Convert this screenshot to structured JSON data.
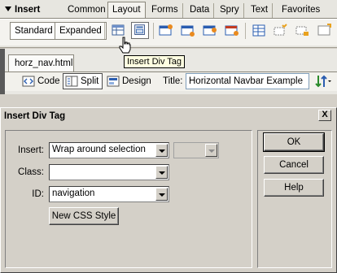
{
  "insert_bar": {
    "title": "Insert",
    "categories": [
      {
        "label": "Common",
        "active": false
      },
      {
        "label": "Layout",
        "active": true
      },
      {
        "label": "Forms",
        "active": false
      },
      {
        "label": "Data",
        "active": false
      },
      {
        "label": "Spry",
        "active": false
      },
      {
        "label": "Text",
        "active": false
      },
      {
        "label": "Favorites",
        "active": false
      }
    ],
    "modes": {
      "standard": "Standard",
      "expanded": "Expanded",
      "selected": "Standard"
    },
    "icons": [
      "table-icon",
      "insert-div-tag-icon",
      "layer-icon-1",
      "layer-icon-2",
      "layer-icon-3",
      "layer-icon-4",
      "frames-icon",
      "tabular-data-icon",
      "spry-icon"
    ]
  },
  "tooltip": "Insert Div Tag",
  "document": {
    "tab_label": "horz_nav.html",
    "views": {
      "code": "Code",
      "split": "Split",
      "design": "Design",
      "selected": "Split"
    },
    "title_label": "Title:",
    "title_value": "Horizontal Navbar Example"
  },
  "dialog": {
    "title": "Insert Div Tag",
    "close_label": "X",
    "insert_label": "Insert:",
    "insert_value": "Wrap around selection",
    "class_label": "Class:",
    "class_value": "",
    "id_label": "ID:",
    "id_value": "navigation",
    "new_css_label": "New CSS Style",
    "ok_label": "OK",
    "cancel_label": "Cancel",
    "help_label": "Help"
  },
  "colors": {
    "chrome": "#d4d0c8",
    "toolbar": "#f4f3ef",
    "tooltip_bg": "#ffffe1",
    "accent_blue": "#2a5db0"
  }
}
